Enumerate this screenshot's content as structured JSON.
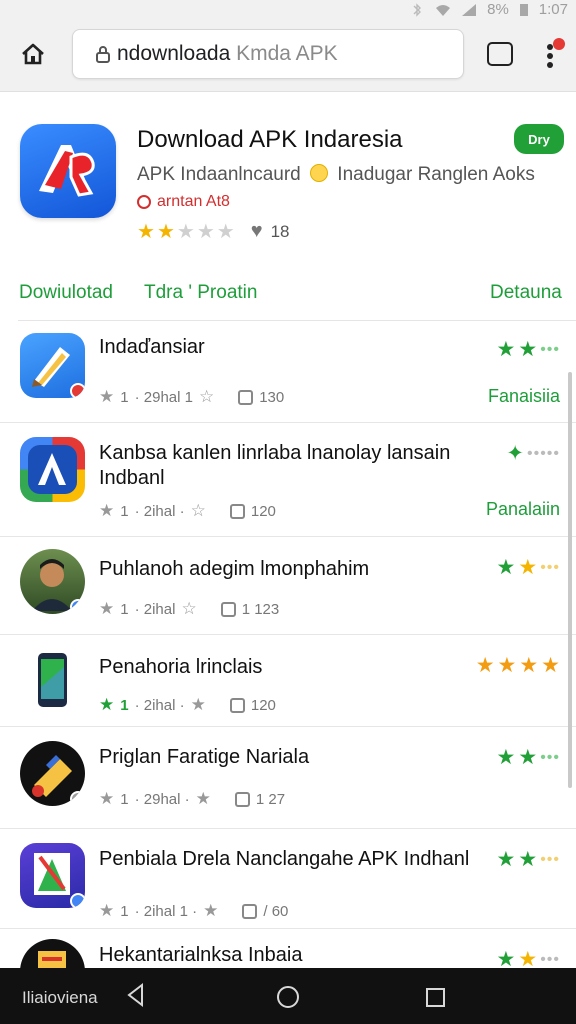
{
  "status_bar": {
    "battery": "8%",
    "time": "1:07"
  },
  "browser": {
    "url_host": "ndownloada",
    "url_path": "Kmda APK",
    "tabs_count": ""
  },
  "header": {
    "title": "Download APK Indaresia",
    "install_label": "Dry",
    "subtitle_a": "APK Indaanlncaurd",
    "subtitle_b": "Inadugar Ranglen Aoks",
    "tag": "arntan At8",
    "rating_stars": 2,
    "rating_count": "18"
  },
  "tabs": [
    "Dowiulotad",
    "Tdra ' Proatin",
    "Detauna"
  ],
  "list": [
    {
      "title": "Indaďansiar",
      "rating_num": "1",
      "meta": "· 29hal 1",
      "count": "130",
      "action": "Fanaisiia"
    },
    {
      "title": "Kanbsa kanlen linrlaba lnanolay lansain Indbanl",
      "rating_num": "1",
      "meta": "· 2ihal ·",
      "count": "120",
      "action": "Panalaiin"
    },
    {
      "title": "Puhlanoh adegim lmonphahim",
      "rating_num": "1",
      "meta": "· 2ihal",
      "count": "1 123",
      "action": ""
    },
    {
      "title": "Penahoria lrinclais",
      "rating_num": "1",
      "meta": "· 2ihal ·",
      "count": "120",
      "action": ""
    },
    {
      "title": "Priglan Faratige Nariala",
      "rating_num": "1",
      "meta": "· 29hal ·",
      "count": "1 27",
      "action": ""
    },
    {
      "title": "Penbiala Drela Nanclangahe APK Indhanl",
      "rating_num": "1",
      "meta": "· 2ihal 1 ·",
      "count": "/ 60",
      "action": ""
    },
    {
      "title": "Hekantarialnksa Inbaia",
      "rating_num": "",
      "meta": "",
      "count": "",
      "action": ""
    }
  ],
  "navbar": {
    "label": "Iliaioviena"
  },
  "colors": {
    "accent_green": "#21a038",
    "star_yellow": "#f4b400",
    "badge_red": "#e53935"
  }
}
